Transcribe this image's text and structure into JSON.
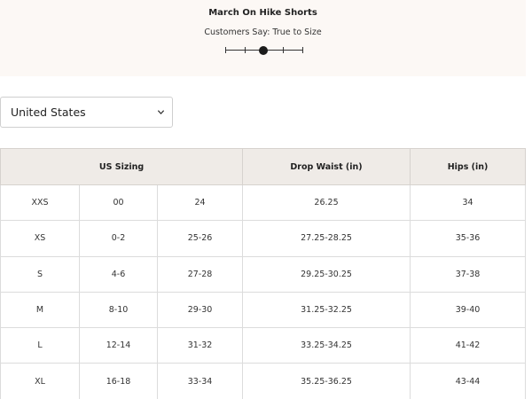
{
  "fit": {
    "product_title": "March On Hike Shorts",
    "customers_say": "Customers Say: True to Size",
    "scale_points": 5,
    "scale_selected_index": 2
  },
  "country_select": {
    "selected": "United States"
  },
  "table": {
    "headers": {
      "us_sizing": "US Sizing",
      "drop_waist": "Drop Waist (in)",
      "hips": "Hips (in)"
    },
    "rows": [
      {
        "size": "XXS",
        "numeric": "00",
        "waist": "24",
        "drop_waist": "26.25",
        "hips": "34"
      },
      {
        "size": "XS",
        "numeric": "0-2",
        "waist": "25-26",
        "drop_waist": "27.25-28.25",
        "hips": "35-36"
      },
      {
        "size": "S",
        "numeric": "4-6",
        "waist": "27-28",
        "drop_waist": "29.25-30.25",
        "hips": "37-38"
      },
      {
        "size": "M",
        "numeric": "8-10",
        "waist": "29-30",
        "drop_waist": "31.25-32.25",
        "hips": "39-40"
      },
      {
        "size": "L",
        "numeric": "12-14",
        "waist": "31-32",
        "drop_waist": "33.25-34.25",
        "hips": "41-42"
      },
      {
        "size": "XL",
        "numeric": "16-18",
        "waist": "33-34",
        "drop_waist": "35.25-36.25",
        "hips": "43-44"
      }
    ]
  }
}
